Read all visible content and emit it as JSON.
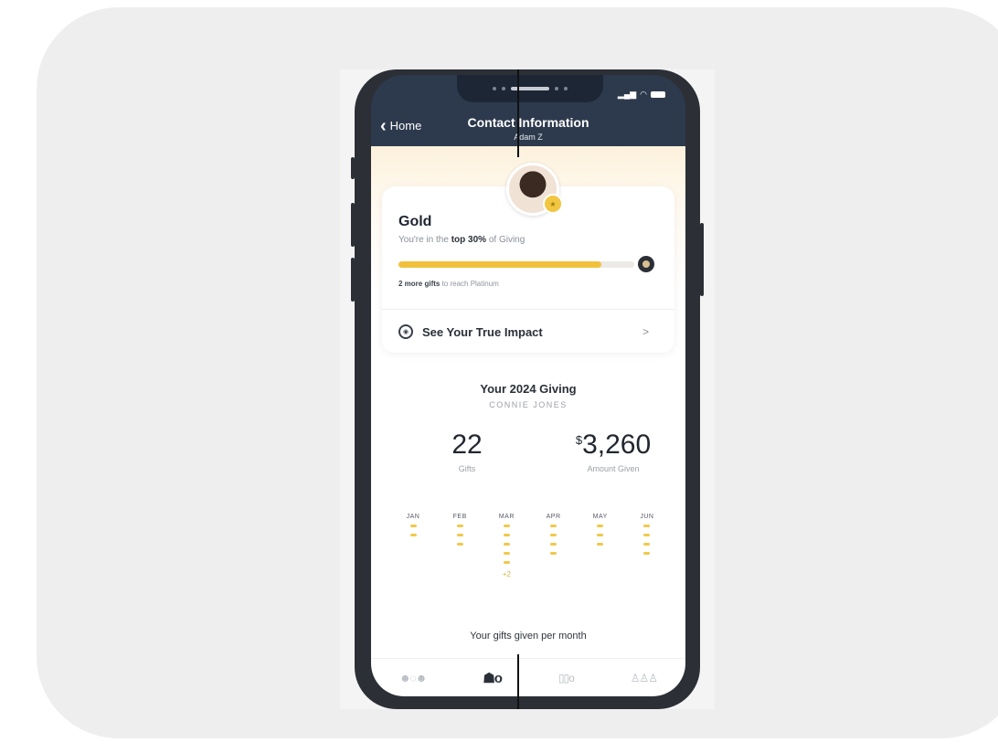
{
  "nav": {
    "back_label": "Home",
    "title": "Contact Information",
    "subtitle": "Adam Z"
  },
  "status_bar": {
    "icons": [
      "signal-icon",
      "wifi-icon",
      "battery-icon"
    ]
  },
  "tier_card": {
    "tier": "Gold",
    "rank_prefix": "You're in the ",
    "rank_bold": "top 30%",
    "rank_suffix": " of Giving",
    "progress_percent": 86,
    "note_bold": "2 more gifts",
    "note_rest": " to reach Platinum",
    "impact_label": "See Your True Impact",
    "impact_chevron": ">"
  },
  "giving": {
    "title": "Your 2024 Giving",
    "name": "CONNIE JONES",
    "gifts_value": "22",
    "gifts_label": "Gifts",
    "amount_currency": "$",
    "amount_value": "3,260",
    "amount_label": "Amount Given",
    "caption": "Your gifts given per month"
  },
  "chart_data": {
    "type": "bar",
    "categories": [
      "JAN",
      "FEB",
      "MAR",
      "APR",
      "MAY",
      "JUN"
    ],
    "values": [
      2,
      3,
      7,
      4,
      3,
      4
    ],
    "visible_marks": [
      2,
      3,
      5,
      4,
      3,
      4
    ],
    "overflow_labels": [
      "",
      "",
      "+2",
      "",
      "",
      ""
    ],
    "xlabel": "Your gifts given per month",
    "colors": {
      "mark": "#f1c84a"
    }
  },
  "tabbar": {
    "items": [
      "people-chat-icon",
      "person-profile-icon",
      "devices-icon",
      "community-icon"
    ],
    "active_index": 1
  },
  "colors": {
    "nav_background": "#2d3a4d",
    "accent_gold": "#f2c13c",
    "frame": "#2c2f35"
  }
}
